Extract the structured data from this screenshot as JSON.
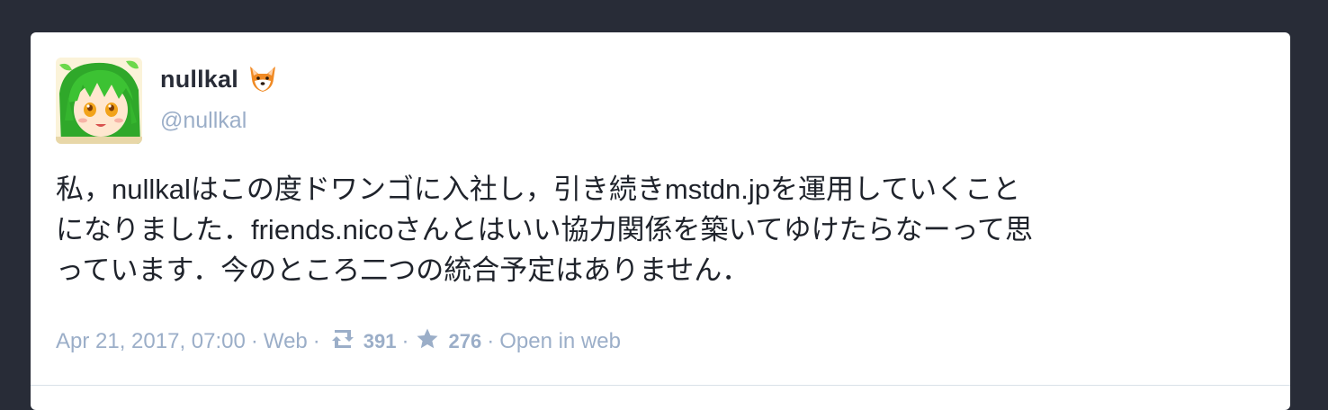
{
  "status": {
    "account": {
      "display_name": "nullkal",
      "acct": "@nullkal",
      "emoji_icon": "fox-face-icon"
    },
    "content_lines": [
      "私，nullkalはこの度ドワンゴに入社し，引き続きmstdn.jpを運用していくこと",
      "になりました．friends.nicoさんとはいい協力関係を築いてゆけたらなーって思",
      "っています．今のところ二つの統合予定はありません．"
    ],
    "meta": {
      "timestamp": "Apr 21, 2017, 07:00",
      "application": "Web",
      "reblogs_count": "391",
      "favourites_count": "276",
      "open_in_web": "Open in web",
      "separator": "·"
    }
  },
  "colors": {
    "page_background": "#282c37",
    "card_background": "#ffffff",
    "muted_text": "#9baec8",
    "primary_text": "#282c37"
  }
}
